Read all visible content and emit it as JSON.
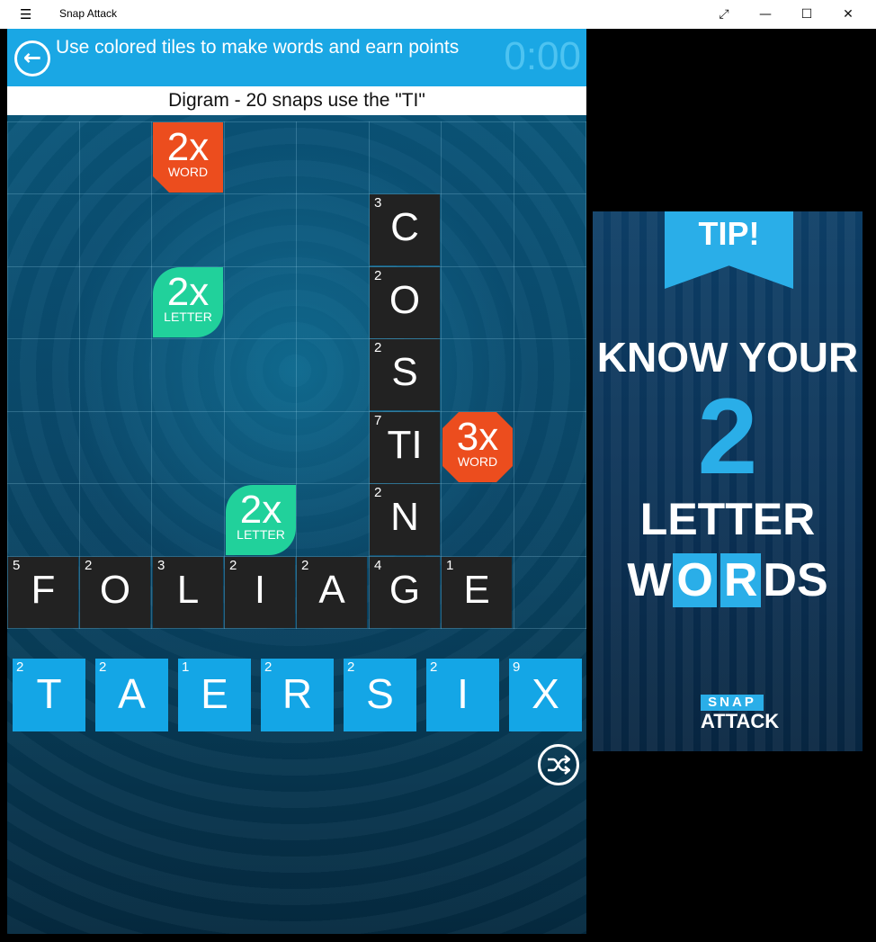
{
  "window": {
    "title": "Snap Attack",
    "menu_icon": "hamburger-icon",
    "controls": [
      "expand-icon",
      "minimize-icon",
      "maximize-icon",
      "close-icon"
    ]
  },
  "header": {
    "instruction": "Use colored tiles to make words and earn points",
    "timer": "0:00",
    "back_icon": "arrow-left-icon"
  },
  "challenge": "Digram - 20 snaps use the \"TI\"",
  "board": {
    "vertical_word": [
      {
        "letter": "C",
        "points": "3"
      },
      {
        "letter": "O",
        "points": "2"
      },
      {
        "letter": "S",
        "points": "2"
      },
      {
        "letter": "TI",
        "points": "7"
      },
      {
        "letter": "N",
        "points": "2"
      }
    ],
    "horizontal_word": [
      {
        "letter": "F",
        "points": "5"
      },
      {
        "letter": "O",
        "points": "2"
      },
      {
        "letter": "L",
        "points": "3"
      },
      {
        "letter": "I",
        "points": "2"
      },
      {
        "letter": "A",
        "points": "2"
      },
      {
        "letter": "G",
        "points": "4"
      },
      {
        "letter": "E",
        "points": "1"
      }
    ],
    "bonuses": [
      {
        "mult": "2x",
        "kind": "WORD"
      },
      {
        "mult": "2x",
        "kind": "LETTER"
      },
      {
        "mult": "3x",
        "kind": "WORD"
      },
      {
        "mult": "2x",
        "kind": "LETTER"
      }
    ]
  },
  "rack": [
    {
      "letter": "T",
      "points": "2"
    },
    {
      "letter": "A",
      "points": "2"
    },
    {
      "letter": "E",
      "points": "1"
    },
    {
      "letter": "R",
      "points": "2"
    },
    {
      "letter": "S",
      "points": "2"
    },
    {
      "letter": "I",
      "points": "2"
    },
    {
      "letter": "X",
      "points": "9"
    }
  ],
  "shuffle_icon": "shuffle-icon",
  "ad": {
    "tip": "TIP!",
    "line1": "KNOW YOUR",
    "number": "2",
    "line2": "LETTER",
    "words": [
      "W",
      "O",
      "R",
      "DS"
    ],
    "logo_top": "SNAP",
    "logo_bottom": "ATTACK"
  },
  "colors": {
    "header": "#1aa7e4",
    "rack_tile": "#14a6e6",
    "word_bonus": "#ec4d1e",
    "letter_bonus": "#21d19b",
    "board_tile": "#222222"
  }
}
